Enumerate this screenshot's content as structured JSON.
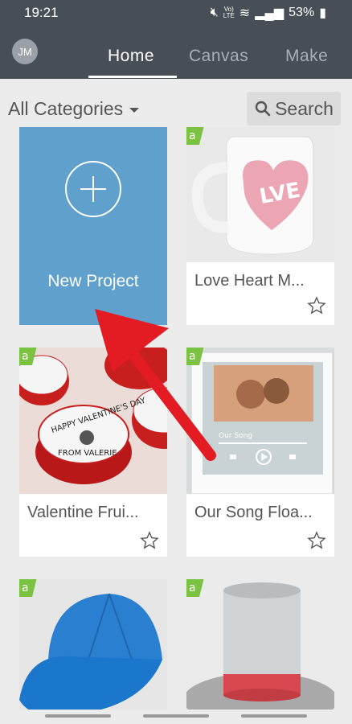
{
  "status": {
    "time": "19:21",
    "network_top": "Vo)",
    "network_bottom": "LTE",
    "battery": "53%"
  },
  "header": {
    "avatar": "JM",
    "tabs": [
      {
        "label": "Home",
        "active": true
      },
      {
        "label": "Canvas",
        "active": false
      },
      {
        "label": "Make",
        "active": false
      }
    ]
  },
  "filter": {
    "category_label": "All Categories",
    "search_label": "Search"
  },
  "new_project": {
    "label": "New Project"
  },
  "projects": [
    {
      "title": "Love Heart M..."
    },
    {
      "title": "Valentine Frui..."
    },
    {
      "title": "Our Song Floa..."
    },
    {
      "title": ""
    },
    {
      "title": ""
    }
  ],
  "colors": {
    "header_bg": "#474e55",
    "new_project_bg": "#5fa0cc",
    "badge_green": "#7cc242",
    "arrow_red": "#e31b23"
  }
}
